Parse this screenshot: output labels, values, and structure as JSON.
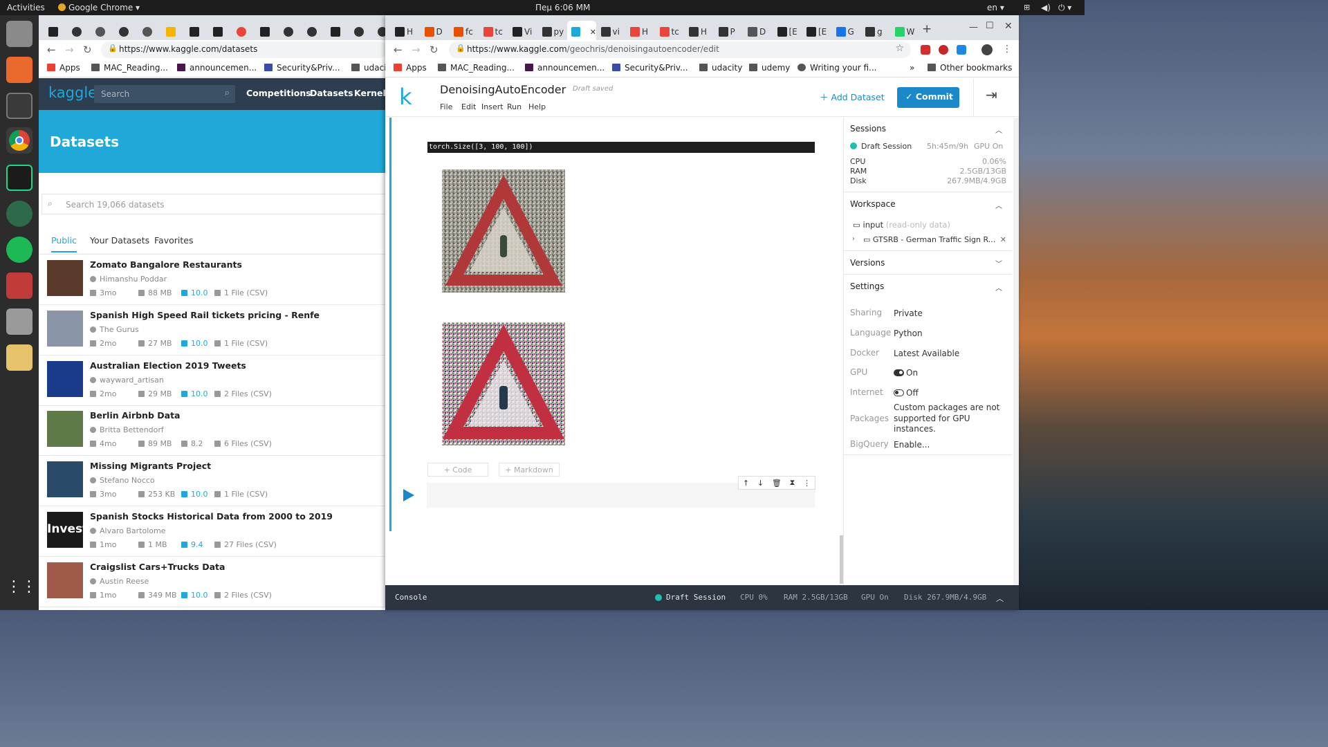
{
  "system": {
    "activities": "Activities",
    "app": "Google Chrome",
    "clock": "Пеμ 6:06 MM",
    "lang": "en"
  },
  "left_window": {
    "tabs": [
      "M",
      "",
      "",
      "",
      "",
      "",
      "",
      "",
      "M",
      "",
      "M",
      "",
      "",
      "",
      "M",
      "",
      ""
    ],
    "url": "https://www.kaggle.com/datasets",
    "bookmarks": [
      "Apps",
      "MAC_Reading...",
      "announcemen...",
      "Security&Priv...",
      "udaci"
    ],
    "kaggle": {
      "logo": "kaggle",
      "search_placeholder": "Search",
      "nav": [
        "Competitions",
        "Datasets",
        "Kernels"
      ],
      "page_title": "Datasets",
      "dataset_search_placeholder": "Search 19,066 datasets",
      "tabs": [
        "Public",
        "Your Datasets",
        "Favorites"
      ],
      "datasets": [
        {
          "title": "Zomato Bangalore Restaurants",
          "author": "Himanshu Poddar",
          "age": "3mo",
          "size": "88 MB",
          "score": "10.0",
          "files": "1 File (CSV)",
          "thumb": "#5a3a2a"
        },
        {
          "title": "Spanish High Speed Rail tickets pricing - Renfe",
          "author": "The Gurus",
          "age": "2mo",
          "size": "27 MB",
          "score": "10.0",
          "files": "1 File (CSV)",
          "thumb": "#8a96a8"
        },
        {
          "title": "Australian Election 2019 Tweets",
          "author": "wayward_artisan",
          "age": "2mo",
          "size": "29 MB",
          "score": "10.0",
          "files": "2 Files (CSV)",
          "thumb": "#1a3a8a"
        },
        {
          "title": "Berlin Airbnb Data",
          "author": "Britta Bettendorf",
          "age": "4mo",
          "size": "89 MB",
          "score": "8.2",
          "files": "6 Files (CSV)",
          "thumb": "#5d7a48"
        },
        {
          "title": "Missing Migrants Project",
          "author": "Stefano Nocco",
          "age": "3mo",
          "size": "253 KB",
          "score": "10.0",
          "files": "1 File (CSV)",
          "thumb": "#2a4a6a"
        },
        {
          "title": "Spanish Stocks Historical Data from 2000 to 2019",
          "author": "Alvaro Bartolome",
          "age": "1mo",
          "size": "1 MB",
          "score": "9.4",
          "files": "27 Files (CSV)",
          "thumb": "#1a1a1a",
          "thumb_text": "Invest"
        },
        {
          "title": "Craigslist Cars+Trucks Data",
          "author": "Austin Reese",
          "age": "1mo",
          "size": "349 MB",
          "score": "10.0",
          "files": "2 Files (CSV)",
          "thumb": "#a05a4a"
        }
      ]
    }
  },
  "right_window": {
    "tabs": [
      "H",
      "D",
      "fc",
      "tc",
      "Vi",
      "py",
      "",
      "vi",
      "H",
      "tc",
      "H",
      "P",
      "D",
      "[E",
      "[E",
      "G",
      "g",
      "W"
    ],
    "url_prefix": "https://www.kaggle.com",
    "url_path": "/geochris/denoisingautoencoder/edit",
    "bookmarks": [
      "Apps",
      "MAC_Reading...",
      "announcemen...",
      "Security&Priv...",
      "udacity",
      "udemy",
      "Writing your fi...",
      "»",
      "Other bookmarks"
    ],
    "kernel": {
      "logo": "k",
      "title": "DenoisingAutoEncoder",
      "save_status": "Draft saved",
      "menu": [
        "File",
        "Edit",
        "Insert",
        "Run",
        "Help"
      ],
      "add_dataset": "Add Dataset",
      "commit": "Commit",
      "output_text": "torch.Size([3, 100, 100])",
      "add_code": "+ Code",
      "add_markdown": "+ Markdown"
    },
    "sidebar": {
      "sessions": {
        "heading": "Sessions",
        "name": "Draft Session",
        "time": "5h:45m/9h",
        "gpu": "GPU On",
        "stats": [
          {
            "k": "CPU",
            "v": "0.06%"
          },
          {
            "k": "RAM",
            "v": "2.5GB/13GB"
          },
          {
            "k": "Disk",
            "v": "267.9MB/4.9GB"
          }
        ]
      },
      "workspace": {
        "heading": "Workspace",
        "input": "input",
        "input_note": "(read-only data)",
        "dataset": "GTSRB - German Traffic Sign R..."
      },
      "versions": {
        "heading": "Versions"
      },
      "settings": {
        "heading": "Settings",
        "rows": [
          {
            "k": "Sharing",
            "v": "Private"
          },
          {
            "k": "Language",
            "v": "Python"
          },
          {
            "k": "Docker",
            "v": "Latest Available"
          },
          {
            "k": "GPU",
            "v": "On"
          },
          {
            "k": "Internet",
            "v": "Off"
          },
          {
            "k": "Packages",
            "v": "Custom packages are not supported for GPU instances."
          },
          {
            "k": "BigQuery",
            "v": "Enable..."
          }
        ]
      }
    },
    "console": {
      "label": "Console",
      "session": "Draft Session",
      "cpu": "CPU 0%",
      "ram": "RAM 2.5GB/13GB",
      "gpu": "GPU On",
      "disk": "Disk 267.9MB/4.9GB"
    }
  },
  "colors": {
    "kaggle_blue": "#20a8d8",
    "kaggle_dark": "#2c3e50",
    "commit_blue": "#1a88c9",
    "session_green": "#20beb0"
  }
}
